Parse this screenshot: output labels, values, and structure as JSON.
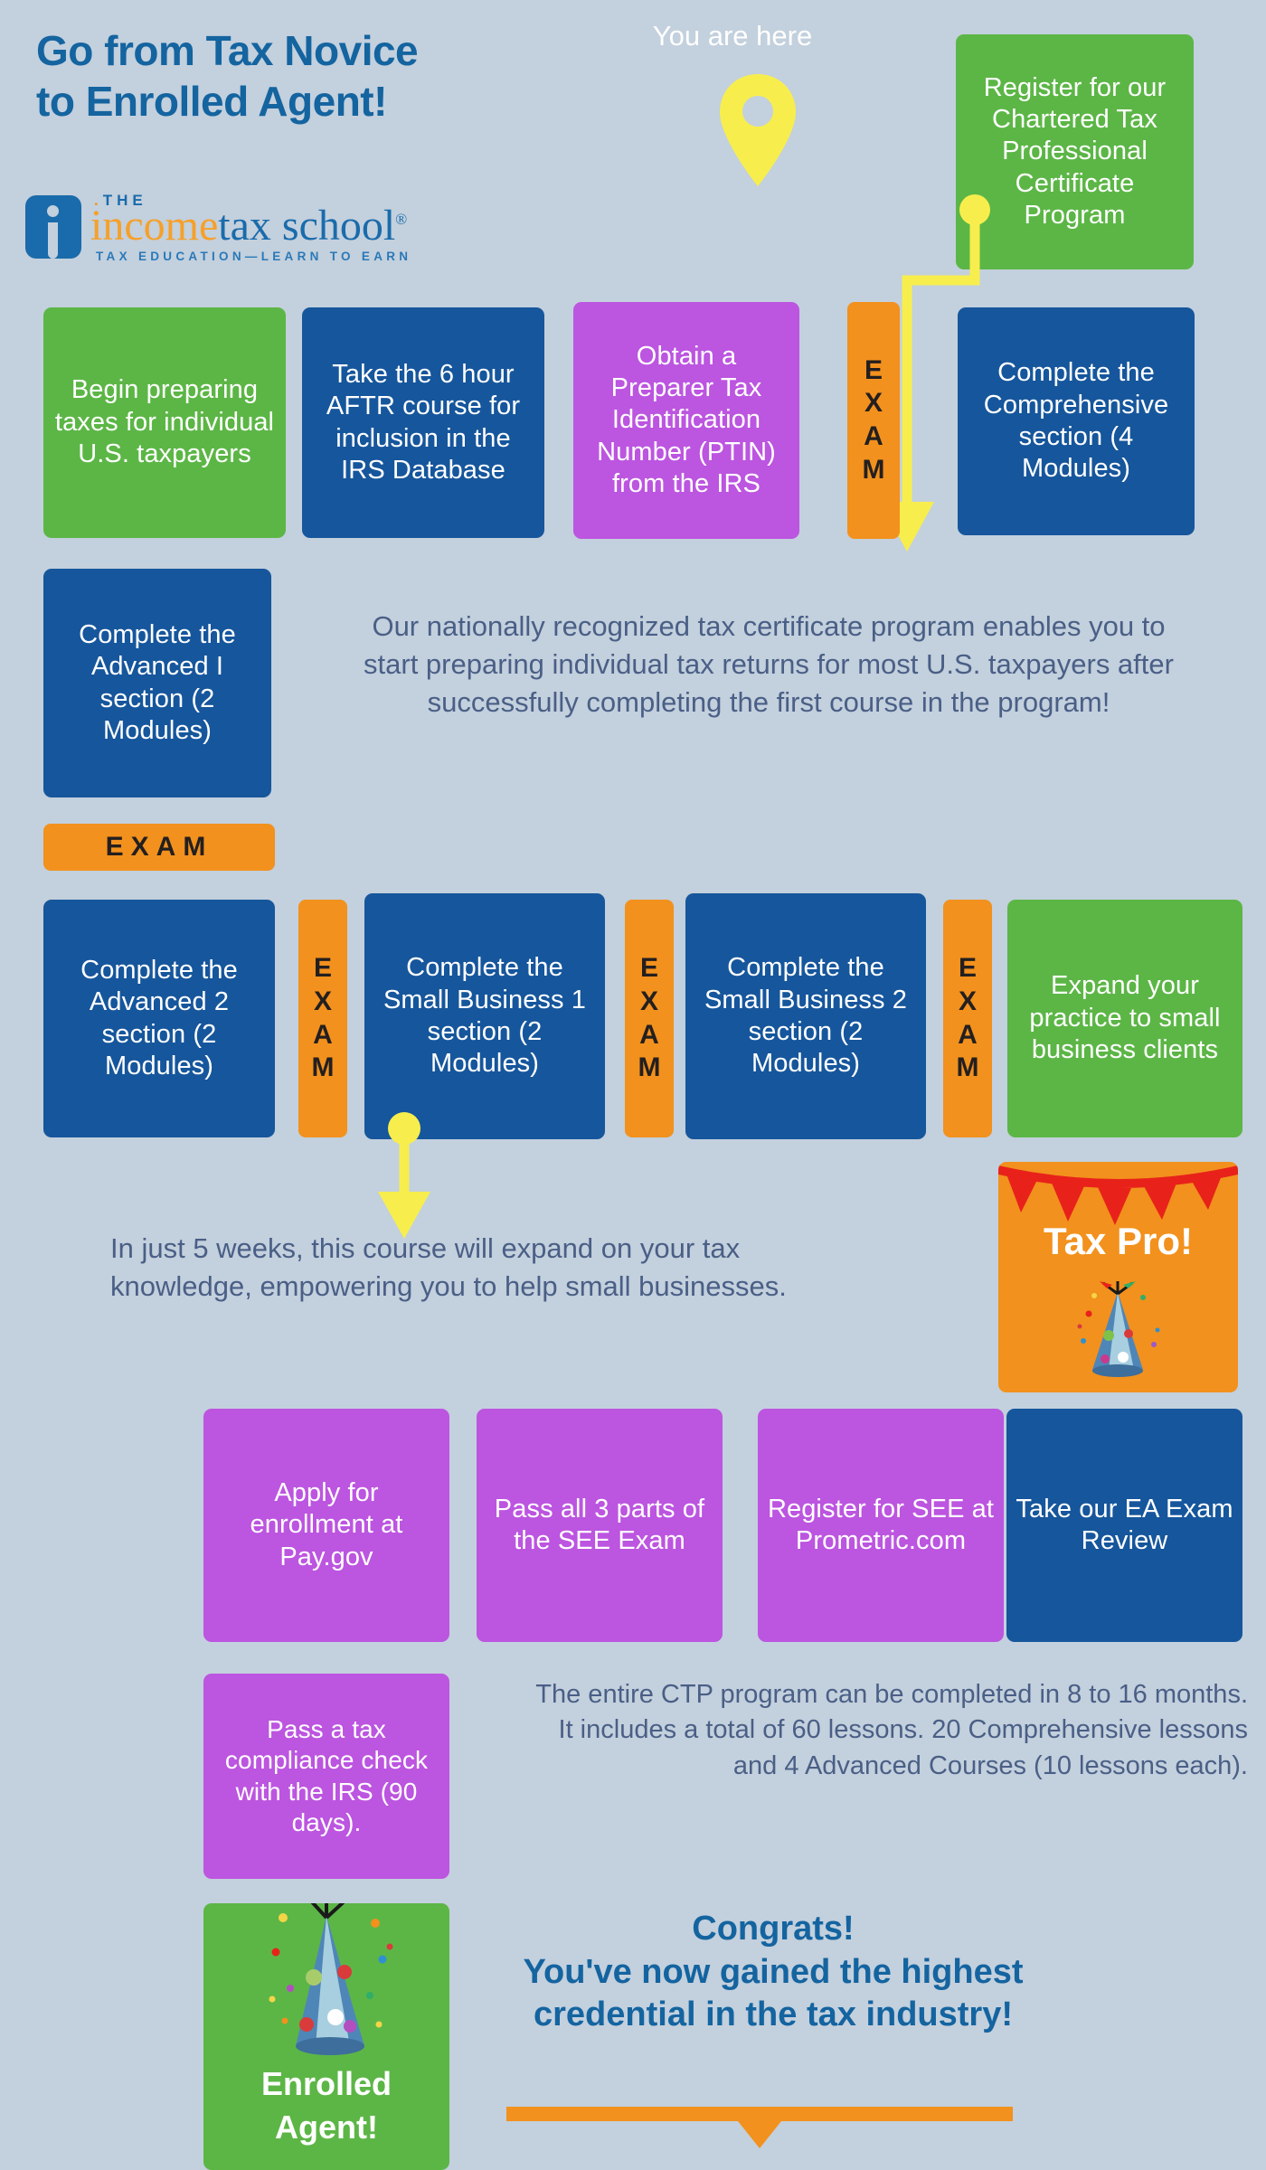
{
  "header": {
    "title_line1": "Go from Tax Novice",
    "title_line2": "to Enrolled Agent!",
    "title_color": "#1464a0"
  },
  "logo": {
    "the": "THE",
    "income": "income",
    "taxschool": "tax school",
    "registered_mark": "®",
    "tagline": "TAX EDUCATION—LEARN TO EARN"
  },
  "you_are_here": {
    "label": "You are here",
    "icon": "map-pin-icon",
    "color": "#f7ee4d"
  },
  "palette": {
    "background": "#c3d0dd",
    "green": "#5cb646",
    "blue": "#16569c",
    "purple": "#bc55e0",
    "orange": "#f2911d",
    "yellow": "#f7ee4d",
    "body_text": "#4a5f86",
    "heading_blue": "#1464a0"
  },
  "steps": {
    "register_ctp": "Register for our Chartered Tax Professional Certificate Program",
    "begin_preparing": "Begin preparing taxes for individual U.S. taxpayers",
    "aftr_course": "Take the 6 hour AFTR course for inclusion in the IRS Database",
    "ptin": "Obtain a Preparer Tax Identification Number (PTIN) from the IRS",
    "comprehensive": "Complete the Comprehensive section (4 Modules)",
    "advanced_1": "Complete the Advanced I section (2 Modules)",
    "advanced_2": "Complete the Advanced 2 section (2 Modules)",
    "small_business_1": "Complete the Small Business 1 section (2 Modules)",
    "small_business_2": "Complete the Small Business 2 section (2 Modules)",
    "expand_practice": "Expand your practice to small business clients",
    "apply_enrollment": "Apply for enrollment at Pay.gov",
    "pass_see": "Pass all 3 parts of the SEE Exam",
    "register_see": "Register for SEE at Prometric.com",
    "ea_exam_review": "Take our EA Exam Review",
    "tax_compliance": "Pass a tax compliance check with the IRS (90 days)."
  },
  "exam_badges": {
    "vertical_letters": [
      "E",
      "X",
      "A",
      "M"
    ],
    "horizontal_label": "EXAM"
  },
  "paragraphs": {
    "program_intro": "Our nationally recognized tax certificate program enables you to start preparing individual tax returns for most U.S. taxpayers after successfully completing the first course in the program!",
    "five_weeks": "In just 5 weeks, this course will expand on your tax knowledge, empowering you to help small businesses.",
    "ctp_duration": "The entire CTP program can be completed in 8 to 16 months. It includes a total of 60 lessons. 20 Comprehensive lessons and 4 Advanced Courses (10 lessons each)."
  },
  "milestones": {
    "tax_pro": "Tax Pro!",
    "enrolled_agent_line1": "Enrolled",
    "enrolled_agent_line2": "Agent!"
  },
  "congrats": {
    "line1": "Congrats!",
    "line2": "You've now gained the highest",
    "line3": "credential in the tax industry!"
  }
}
